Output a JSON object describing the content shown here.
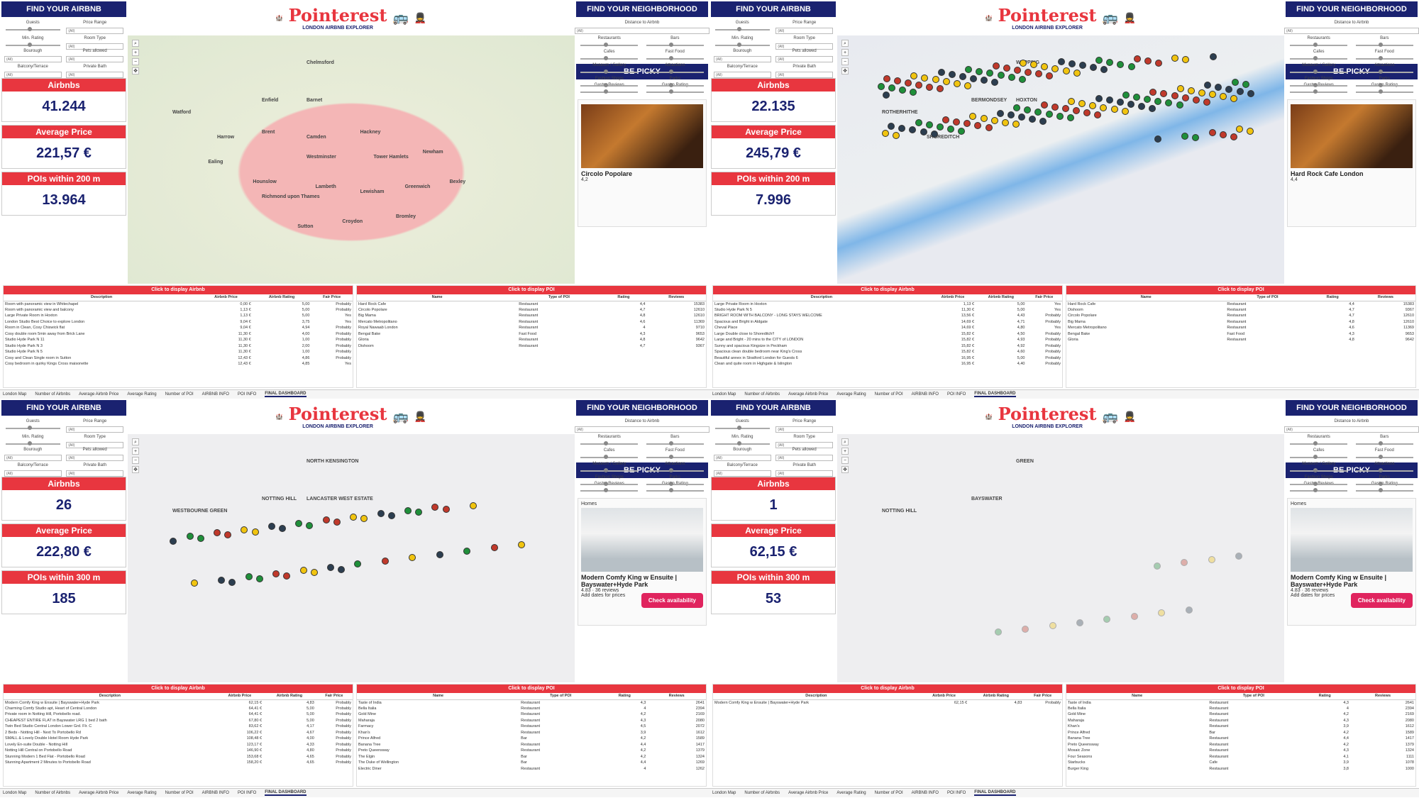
{
  "common": {
    "find_airbnb": "FIND YOUR AIRBNB",
    "find_neighborhood": "FIND YOUR NEIGHBORHOOD",
    "be_picky": "BE PICKY",
    "logo": "Pointerest",
    "logo_sub": "LONDON AIRBNB EXPLORER",
    "guests": "Guests",
    "price_range": "Price Range",
    "min_rating": "Min. Rating",
    "room_type": "Room Type",
    "borough": "Bourough",
    "pets": "Pets allowed",
    "balcony": "Balcony/Terrace",
    "private_bath": "Private Bath",
    "distance": "Distance to Airbnb",
    "restaurants": "Restaurants",
    "bars": "Bars",
    "cafes": "Cafes",
    "fast_food": "Fast Food",
    "museum": "Museum / Gallery",
    "attractions": "Attractions",
    "fashion": "Fashion Shops",
    "parks": "Parks",
    "subway": "Subway Nearby",
    "gastro_reviews": "Gastro Reviews",
    "gastro_rating": "Gastro Rating",
    "airbnbs": "Airbnbs",
    "avg_price": "Average Price",
    "click_airbnb": "Click to display Airbnb",
    "click_poi": "Click to display POI",
    "all": "(All)",
    "multiple": "(Multiple values)",
    "col_desc": "Description",
    "col_price": "Airbnb Price",
    "col_rating": "Airbnb Rating",
    "col_fair": "Fair Price",
    "col_name": "Name",
    "col_type": "Type of POI",
    "col_prating": "Rating",
    "col_reviews": "Reviews",
    "tabs": [
      "London Map",
      "Number of Airbnbs",
      "Average Airbnb Price",
      "Average Rating",
      "Number of POI",
      "AIRBNB INFO",
      "POI INFO",
      "FINAL DASHBOARD"
    ],
    "colors": {
      "navy": "#1a2270",
      "red": "#e8363f"
    }
  },
  "q1": {
    "airbnbs": "41.244",
    "price": "221,57 €",
    "poi_label": "POIs within 200 m",
    "poi": "13.964",
    "popup_title": "Circolo Popolare",
    "popup_rating": "4,2",
    "map_labels": [
      "Chelmsford",
      "Watford",
      "Enfield",
      "Barnet",
      "Harrow",
      "Brent",
      "Camden",
      "Hackney",
      "Ealing",
      "Westminster",
      "Tower Hamlets",
      "Newham",
      "Hounslow",
      "Richmond upon Thames",
      "Lambeth",
      "Lewisham",
      "Greenwich",
      "Bexley",
      "Croydon",
      "Sutton",
      "Bromley"
    ],
    "airbnb_rows": [
      [
        "Room with panoramic view in Whitechapel",
        "0,00 €",
        "5,00",
        "Probably"
      ],
      [
        "Room with panoramic view and balcony",
        "1,13 €",
        "5,00",
        "Probably"
      ],
      [
        "Large Private Room in Hoxton",
        "1,13 €",
        "5,00",
        "Yes"
      ],
      [
        "London Studio Best Choice to explore London",
        "9,04 €",
        "3,75",
        "Yes"
      ],
      [
        "Room in Clean, Cosy Chiswick flat",
        "9,04 €",
        "4,94",
        "Probably"
      ],
      [
        "Cosy double room 5min away from Brick Lane",
        "11,30 €",
        "4,00",
        "Probably"
      ],
      [
        "Studio Hyde Park N 11",
        "11,30 €",
        "1,00",
        "Probably"
      ],
      [
        "Studio Hyde Park N 3",
        "11,30 €",
        "2,00",
        "Probably"
      ],
      [
        "Studio Hyde Park N 5",
        "11,30 €",
        "1,00",
        "Probably"
      ],
      [
        "Cosy and Clean Single room in Sutton",
        "12,43 €",
        "4,86",
        "Probably"
      ],
      [
        "Cosy bedroom in quirky Kings Cross maisonette",
        "12,43 €",
        "4,85",
        "Yes"
      ]
    ],
    "poi_rows": [
      [
        "Hard Rock Cafe",
        "Restaurant",
        "4,4",
        "15383"
      ],
      [
        "Circolo Popolare",
        "Restaurant",
        "4,7",
        "12610"
      ],
      [
        "Big Mama",
        "Restaurant",
        "4,8",
        "12610"
      ],
      [
        "Mercato Metropolitano",
        "Restaurant",
        "4,6",
        "11369"
      ],
      [
        "Royal Nawaab London",
        "Restaurant",
        "4",
        "9710"
      ],
      [
        "Bengal Bake",
        "Fast Food",
        "4,3",
        "9653"
      ],
      [
        "Gloria",
        "Restaurant",
        "4,8",
        "9642"
      ],
      [
        "Dishoom",
        "Restaurant",
        "4,7",
        "9367"
      ]
    ]
  },
  "q2": {
    "airbnbs": "22.135",
    "price": "245,79 €",
    "poi_label": "POIs within 200 m",
    "poi": "7.996",
    "popup_title": "Hard Rock Cafe London",
    "popup_rating": "4,4",
    "map_labels": [
      "WAPPING",
      "ROTHERHITHE",
      "BERMONDSEY",
      "HOXTON",
      "SHOREDITCH"
    ],
    "airbnb_rows": [
      [
        "Large Private Room in Hoxton",
        "1,13 €",
        "5,00",
        "Yes"
      ],
      [
        "Studio Hyde Park N 5",
        "11,30 €",
        "5,00",
        "Yes"
      ],
      [
        "BRIGHT ROOM WITH BALCONY - LONG STAYS WELCOME",
        "13,56 €",
        "4,43",
        "Probably"
      ],
      [
        "Spacious and Bright in Aldgate",
        "14,69 €",
        "4,71",
        "Probably"
      ],
      [
        "Cheval Place",
        "14,69 €",
        "4,80",
        "Yes"
      ],
      [
        "Large Double close to Shoreditch!!",
        "15,82 €",
        "4,50",
        "Probably"
      ],
      [
        "Large and Bright - 20 mins to the CITY of LONDON",
        "15,82 €",
        "4,93",
        "Probably"
      ],
      [
        "Sunny and spacious Kingsize in Peckham",
        "15,82 €",
        "4,92",
        "Probably"
      ],
      [
        "Spacious clean double bedroom near King's Cross",
        "15,82 €",
        "4,60",
        "Probably"
      ],
      [
        "Beautiful annex in Stratford London for Guests 6",
        "16,95 €",
        "5,00",
        "Probably"
      ],
      [
        "Clean and quite room in Highgate & Islington",
        "16,95 €",
        "4,40",
        "Probably"
      ]
    ],
    "poi_rows": [
      [
        "Hard Rock Cafe",
        "Restaurant",
        "4,4",
        "15383"
      ],
      [
        "Dishoom",
        "Restaurant",
        "4,7",
        "9367"
      ],
      [
        "Circolo Popolare",
        "Restaurant",
        "4,7",
        "12610"
      ],
      [
        "Big Mama",
        "Restaurant",
        "4,8",
        "12610"
      ],
      [
        "Mercato Metropolitano",
        "Restaurant",
        "4,6",
        "11369"
      ],
      [
        "Bengal Bake",
        "Fast Food",
        "4,3",
        "9653"
      ],
      [
        "Gloria",
        "Restaurant",
        "4,8",
        "9642"
      ]
    ]
  },
  "q3": {
    "airbnbs": "26",
    "price": "222,80 €",
    "poi_label": "POIs within 300 m",
    "poi": "185",
    "popup_title": "Modern Comfy King w Ensuite | Bayswater+Hyde Park",
    "popup_rating": "4.83 · 36 reviews",
    "popup_homes": "Homes",
    "popup_prices": "Add dates for prices",
    "popup_btn": "Check availability",
    "map_labels": [
      "NORTH KENSINGTON",
      "WESTBOURNE GREEN",
      "NOTTING HILL",
      "LANCASTER WEST ESTATE"
    ],
    "airbnb_rows": [
      [
        "Modern Comfy King w Ensuite | Bayswater+Hyde Park",
        "62,15 €",
        "4,83",
        "Probably"
      ],
      [
        "Charming Comfy Studio apt, Heart of Central London",
        "64,41 €",
        "5,00",
        "Probably"
      ],
      [
        "Private room in Notting Hill, Portobello road.",
        "64,41 €",
        "5,00",
        "Probably"
      ],
      [
        "CHEAPEST ENTIRE FLAT in Bayswater LRG 1 bed 2 bath",
        "67,80 €",
        "5,00",
        "Probably"
      ],
      [
        "Twin Bed Studio Central London Lower Grd. Flr. C",
        "83,62 €",
        "4,17",
        "Probably"
      ],
      [
        "2 Beds - Notting Hill - Next To Portobello Rd",
        "106,22 €",
        "4,67",
        "Probably"
      ],
      [
        "SMALL & Lovely Double Hotel Room Hyde Park",
        "108,48 €",
        "4,00",
        "Probably"
      ],
      [
        "Lovely En-suite Double - Notting Hill",
        "123,17 €",
        "4,33",
        "Probably"
      ],
      [
        "Notting Hill Central on Portobello Road",
        "146,90 €",
        "4,80",
        "Probably"
      ],
      [
        "Stunning Modern 1 Bed Flat - Portobello Road",
        "153,68 €",
        "4,65",
        "Probably"
      ],
      [
        "Stunning Apartment 2 Minutes to Portobello Road",
        "158,20 €",
        "4,65",
        "Probably"
      ]
    ],
    "poi_rows": [
      [
        "Taste of India",
        "Restaurant",
        "4,3",
        "2641"
      ],
      [
        "Bella Italia",
        "Restaurant",
        "4",
        "2394"
      ],
      [
        "Gold Mine",
        "Restaurant",
        "4,2",
        "2169"
      ],
      [
        "Maharaja",
        "Restaurant",
        "4,3",
        "2080"
      ],
      [
        "Farmacy",
        "Restaurant",
        "4,5",
        "2072"
      ],
      [
        "Khan's",
        "Restaurant",
        "3,9",
        "1612"
      ],
      [
        "Prince Alfred",
        "Bar",
        "4,2",
        "1589"
      ],
      [
        "Banana Tree",
        "Restaurant",
        "4,4",
        "1417"
      ],
      [
        "Preto Queensway",
        "Restaurant",
        "4,2",
        "1379"
      ],
      [
        "The Elgin",
        "Bar",
        "4,2",
        "1324"
      ],
      [
        "The Duke of Wellington",
        "Bar",
        "4,4",
        "1269"
      ],
      [
        "Electric Diner",
        "Restaurant",
        "4",
        "1262"
      ]
    ]
  },
  "q4": {
    "airbnbs": "1",
    "price": "62,15 €",
    "poi_label": "POIs within 300 m",
    "poi": "53",
    "popup_title": "Modern Comfy King w Ensuite | Bayswater+Hyde Park",
    "popup_rating": "4.83 · 36 reviews",
    "popup_homes": "Homes",
    "popup_prices": "Add dates for prices",
    "popup_btn": "Check availability",
    "map_labels": [
      "GREEN",
      "NOTTING HILL",
      "BAYSWATER"
    ],
    "airbnb_rows": [
      [
        "Modern Comfy King w Ensuite | Bayswater+Hyde Park",
        "62,15 €",
        "4,83",
        "Probably"
      ]
    ],
    "poi_rows": [
      [
        "Taste of India",
        "Restaurant",
        "4,3",
        "2641"
      ],
      [
        "Bella Italia",
        "Restaurant",
        "4",
        "2394"
      ],
      [
        "Gold Mine",
        "Restaurant",
        "4,2",
        "2169"
      ],
      [
        "Maharaja",
        "Restaurant",
        "4,3",
        "2080"
      ],
      [
        "Khan's",
        "Restaurant",
        "3,9",
        "1612"
      ],
      [
        "Prince Alfred",
        "Bar",
        "4,2",
        "1589"
      ],
      [
        "Banana Tree",
        "Restaurant",
        "4,4",
        "1417"
      ],
      [
        "Preto Queensway",
        "Restaurant",
        "4,2",
        "1379"
      ],
      [
        "Mosaic Zone",
        "Restaurant",
        "4,3",
        "1324"
      ],
      [
        "Four Seasons",
        "Restaurant",
        "4,1",
        "1111"
      ],
      [
        "Starbucks",
        "Cafe",
        "3,9",
        "1078"
      ],
      [
        "Burger King",
        "Restaurant",
        "3,8",
        "1000"
      ]
    ]
  }
}
